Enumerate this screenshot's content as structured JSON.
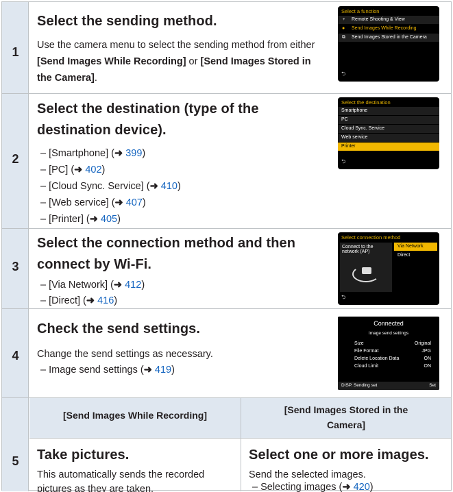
{
  "steps": [
    {
      "num": "1",
      "title": "Select the sending method.",
      "body_pre": "Use the camera menu to select the sending method from either ",
      "body_b1": "[Send Images While Recording]",
      "body_mid": " or ",
      "body_b2": "[Send Images Stored in the Camera]",
      "body_post": ".",
      "screen": {
        "header": "Select a function",
        "items": [
          "Remote Shooting & View",
          "Send Images While Recording",
          "Send Images Stored in the Camera"
        ],
        "selected": 1
      }
    },
    {
      "num": "2",
      "title_l1": "Select the destination (type of the",
      "title_l2": "destination device).",
      "items": [
        {
          "label": "– [Smartphone] (",
          "page": "399"
        },
        {
          "label": "– [PC] (",
          "page": "402"
        },
        {
          "label": "– [Cloud Sync. Service] (",
          "page": "410"
        },
        {
          "label": "– [Web service] (",
          "page": "407"
        },
        {
          "label": "– [Printer] (",
          "page": "405"
        }
      ],
      "screen": {
        "header": "Select the destination",
        "items": [
          "Smartphone",
          "PC",
          "Cloud Sync. Service",
          "Web service",
          "Printer"
        ],
        "selected": 4
      }
    },
    {
      "num": "3",
      "title_l1": "Select the connection method and then",
      "title_l2": "connect by Wi-Fi.",
      "items": [
        {
          "label": "– [Via Network] (",
          "page": "412"
        },
        {
          "label": "– [Direct] (",
          "page": "416"
        }
      ],
      "screen": {
        "header": "Select connection method",
        "left_text_l1": "Connect to the",
        "left_text_l2": "network (AP)",
        "options": [
          "Via Network",
          "Direct"
        ],
        "selected": 0
      }
    },
    {
      "num": "4",
      "title": "Check the send settings.",
      "body": "Change the send settings as necessary.",
      "item": {
        "label": "– Image send settings (",
        "page": "419"
      },
      "screen": {
        "title": "Connected",
        "subtitle": "Image send settings",
        "rows": [
          {
            "k": "Size",
            "v": "Original"
          },
          {
            "k": "File Format",
            "v": "JPG"
          },
          {
            "k": "Delete Location Data",
            "v": "ON"
          },
          {
            "k": "Cloud Limit",
            "v": "ON"
          }
        ],
        "footer_left": "DISP. Sending set",
        "footer_right": "Set"
      }
    },
    {
      "num": "5",
      "left": {
        "header": "[Send Images While Recording]",
        "title": "Take pictures.",
        "body_l1": "This automatically sends the recorded",
        "body_l2": "pictures as they are taken."
      },
      "right": {
        "header_l1": "[Send Images Stored in the",
        "header_l2": "Camera]",
        "title": "Select one or more images.",
        "body": "Send the selected images.",
        "item": {
          "label": "– Selecting images (",
          "page": "420"
        }
      }
    }
  ],
  "arrow_glyph": "➜",
  "close_paren": ")",
  "back_glyph": "⮌",
  "colors": {
    "accent_row": "#dfe7f0",
    "link": "#1565c0",
    "highlight": "#f2b800",
    "border": "#bfc3c6"
  }
}
